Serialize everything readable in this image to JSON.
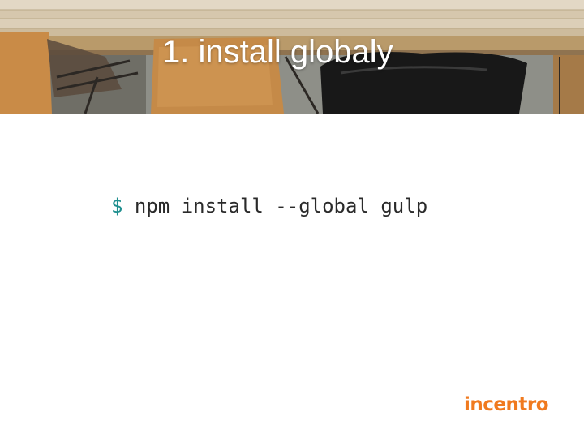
{
  "slide": {
    "title": "1. install globaly",
    "command": {
      "prompt": "$",
      "text": "npm install --global gulp"
    },
    "logo_text": "incentro"
  },
  "colors": {
    "title_text": "#ffffff",
    "prompt": "#1f8f8f",
    "command_text": "#2a2a2a",
    "logo": "#f07a1f",
    "background": "#ffffff"
  },
  "header_image": {
    "icon": "wooden-table-with-chairs-photo"
  }
}
